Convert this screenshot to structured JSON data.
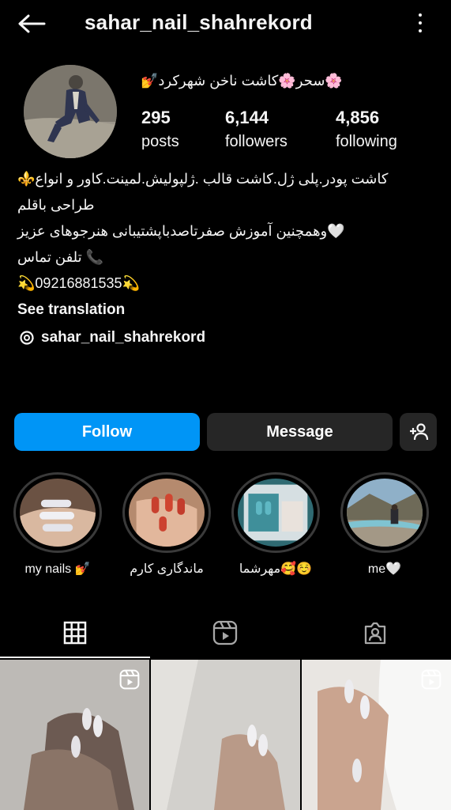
{
  "header": {
    "username": "sahar_nail_shahrekord"
  },
  "profile": {
    "display_name": "🌸سحر🌸کاشت ناخن شهرکرد💅",
    "stats": [
      {
        "value": "295",
        "label": "posts"
      },
      {
        "value": "6,144",
        "label": "followers"
      },
      {
        "value": "4,856",
        "label": "following"
      }
    ],
    "bio": {
      "line1": "کاشت پودر.پلی ژل.کاشت قالب .ژلپولیش.لمینت.کاور و انواع⚜️",
      "line2": "طراحی باقلم",
      "line3": "🤍وهمچنین آموزش صفرتاصدباپشتیبانی هنرجوهای عزیز",
      "line4": "📞 تلفن تماس",
      "line5": "💫09216881535💫",
      "see_translation": "See translation"
    },
    "threads_handle": "sahar_nail_shahrekord"
  },
  "actions": {
    "follow": "Follow",
    "message": "Message"
  },
  "highlights": [
    {
      "label": "my nails 💅"
    },
    {
      "label": "ماندگاری کارم"
    },
    {
      "label": "مهرشما🥰☺️"
    },
    {
      "label": "me🤍"
    }
  ],
  "colors": {
    "background": "#000000",
    "follow_button": "#0095f6",
    "secondary_button": "#262626",
    "text": "#f5f5f5"
  },
  "icons": {
    "tabs": [
      "grid-icon",
      "reels-icon",
      "tagged-icon"
    ]
  }
}
